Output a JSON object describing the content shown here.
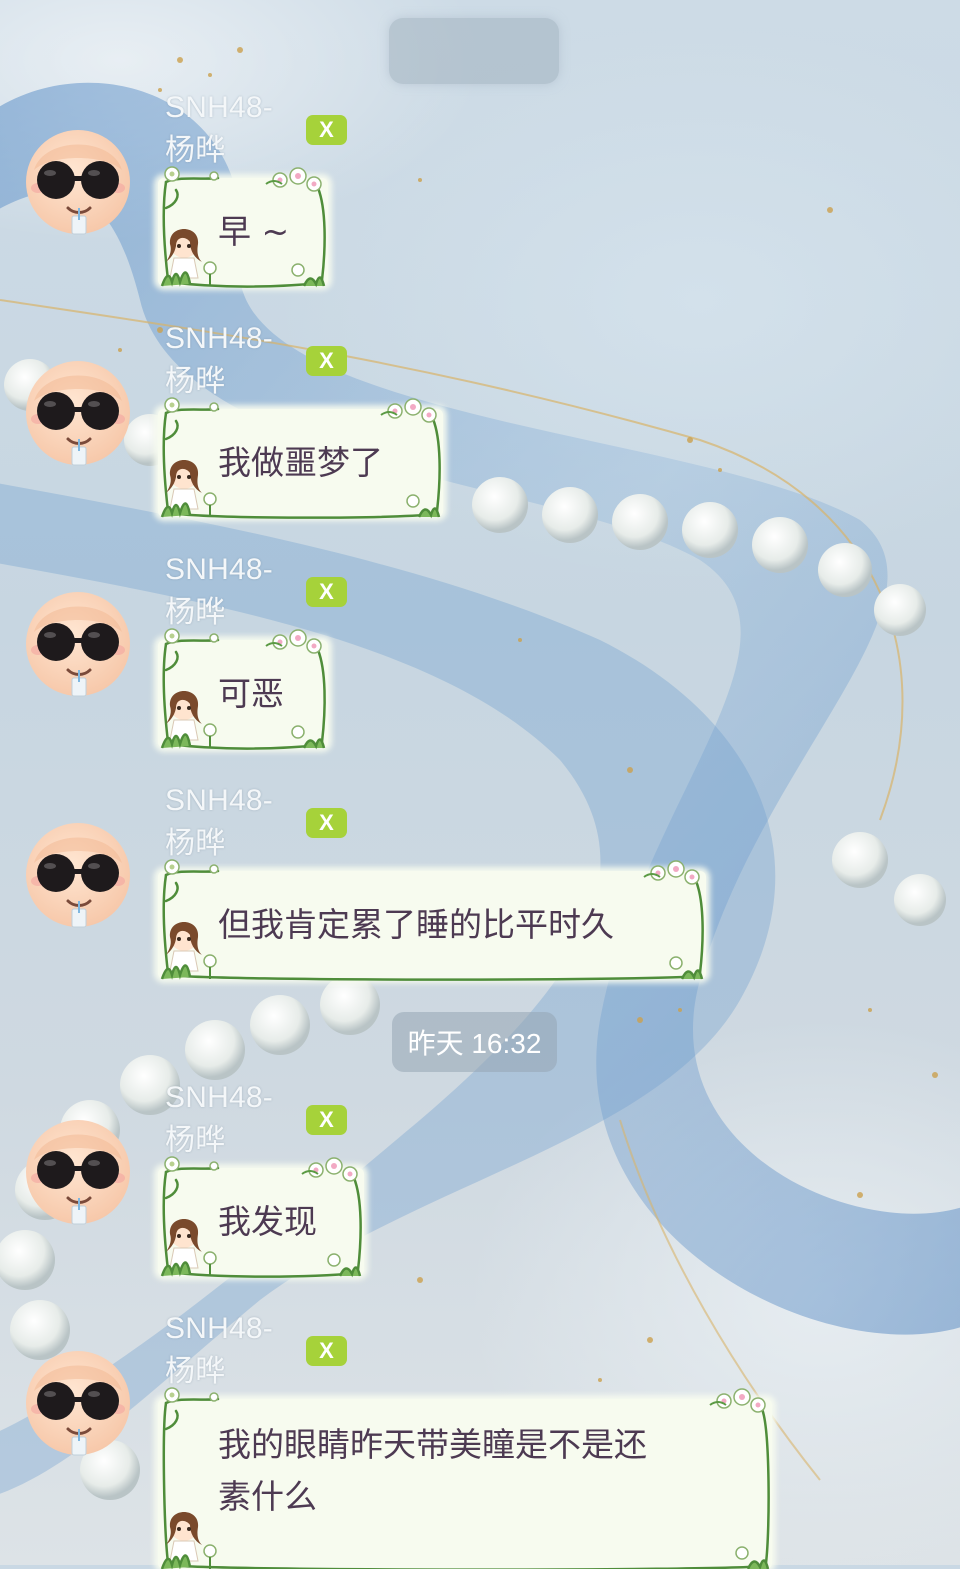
{
  "chat": {
    "top_title": "",
    "timestamp": "昨天 16:32",
    "messages": [
      {
        "sender": "SNH48-杨晔",
        "badge": "X",
        "text": "早 ~"
      },
      {
        "sender": "SNH48-杨晔",
        "badge": "X",
        "text": "我做噩梦了"
      },
      {
        "sender": "SNH48-杨晔",
        "badge": "X",
        "text": "可恶"
      },
      {
        "sender": "SNH48-杨晔",
        "badge": "X",
        "text": "但我肯定累了睡的比平时久"
      },
      {
        "sender": "SNH48-杨晔",
        "badge": "X",
        "text": "我发现"
      },
      {
        "sender": "SNH48-杨晔",
        "badge": "X",
        "text": "我的眼睛昨天带美瞳是不是还\n素什么"
      }
    ]
  },
  "colors": {
    "badge": "#a6d23a",
    "bubble": "#f7fbef",
    "bubble_text": "#4d3a52",
    "sender_text": "#f4f7f9"
  },
  "icons": {
    "avatar": "cartoon-face-sunglasses-icon",
    "bubble_decoration": "flower-girl-frame"
  }
}
